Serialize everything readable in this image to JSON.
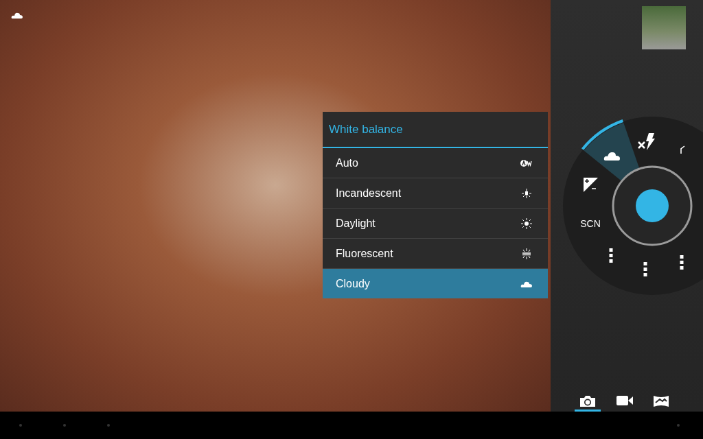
{
  "menu": {
    "title": "White balance",
    "items": [
      {
        "label": "Auto",
        "kind": "auto",
        "selected": false
      },
      {
        "label": "Incandescent",
        "kind": "incandescent",
        "selected": false
      },
      {
        "label": "Daylight",
        "kind": "daylight",
        "selected": false
      },
      {
        "label": "Fluorescent",
        "kind": "fluorescent",
        "selected": false
      },
      {
        "label": "Cloudy",
        "kind": "cloudy",
        "selected": true
      }
    ]
  },
  "pie": {
    "scene_label": "SCN",
    "highlighted": true
  },
  "modes": [
    {
      "kind": "photo",
      "selected": true
    },
    {
      "kind": "video",
      "selected": false
    },
    {
      "kind": "panorama",
      "selected": false
    }
  ]
}
